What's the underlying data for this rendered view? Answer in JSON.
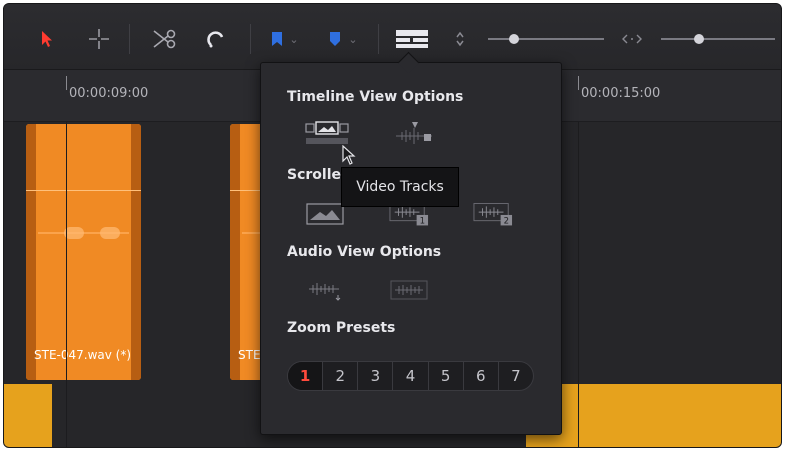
{
  "toolbar": {
    "icons": [
      "pointer-arrow-icon",
      "blade-crosshair-icon",
      "scissors-icon",
      "snapping-magnet-icon",
      "flag-icon",
      "marker-icon",
      "timeline-view-options-icon",
      "stepper-icon",
      "zoom-slider",
      "audio-width-icon",
      "width-slider"
    ]
  },
  "ruler": {
    "timecodes": [
      "00:00:09:00",
      "00:00:15:00"
    ]
  },
  "clips": [
    {
      "name": "STE-047.wav (*)"
    },
    {
      "name": "STE"
    }
  ],
  "popup": {
    "timeline_view_title": "Timeline View Options",
    "scroller_title": "Scroller",
    "audio_view_title": "Audio View Options",
    "zoom_title": "Zoom Presets",
    "tooltip": "Video Tracks",
    "scroller_badges": [
      "1",
      "2"
    ],
    "zoom_presets": [
      "1",
      "2",
      "3",
      "4",
      "5",
      "6",
      "7"
    ],
    "selected_zoom": "1"
  },
  "colors": {
    "clip_orange": "#f08a24",
    "clip_yellow": "#e6a21d",
    "selected_red": "#ff4a3c",
    "accent_blue": "#2f6fe0"
  }
}
